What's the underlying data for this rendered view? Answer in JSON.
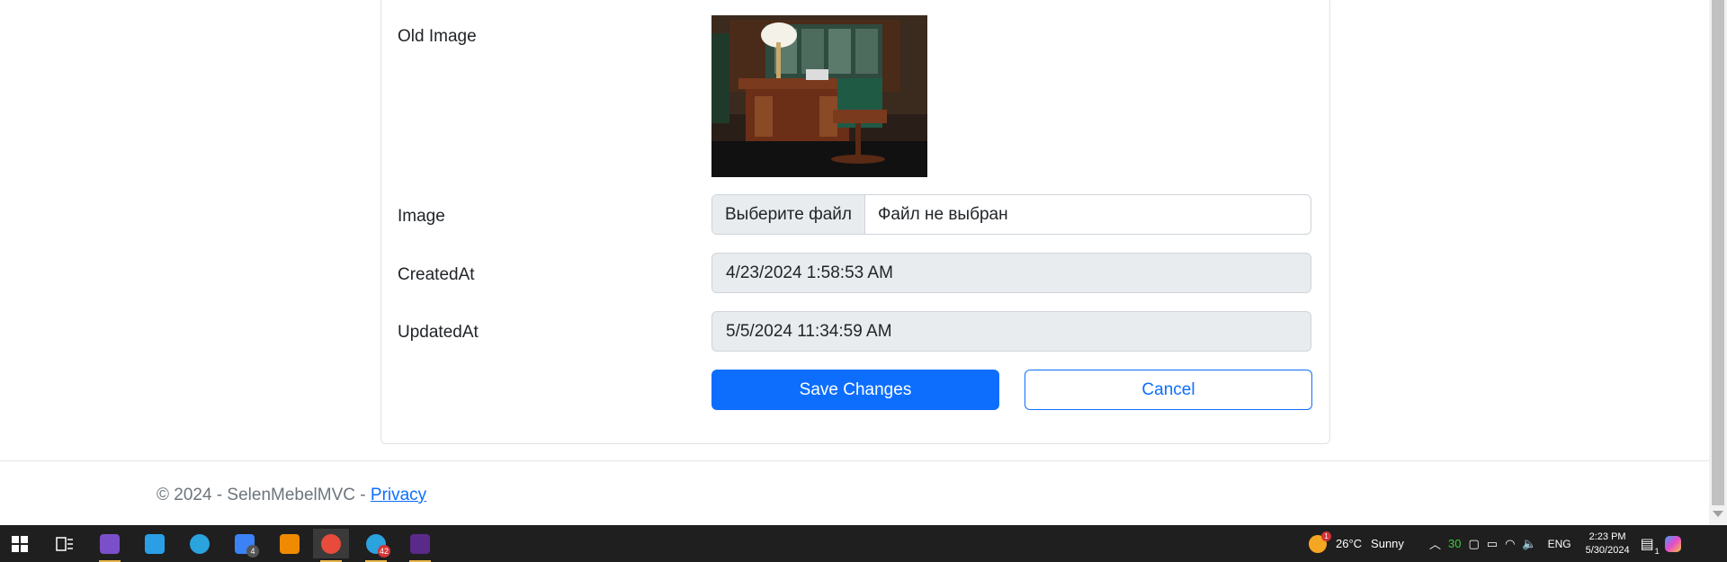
{
  "form": {
    "old_image_label": "Old Image",
    "image_label": "Image",
    "file_button_label": "Выберите файл",
    "file_status": "Файл не выбран",
    "created_label": "CreatedAt",
    "created_value": "4/23/2024 1:58:53 AM",
    "updated_label": "UpdatedAt",
    "updated_value": "5/5/2024 11:34:59 AM",
    "save_label": "Save Changes",
    "cancel_label": "Cancel"
  },
  "footer": {
    "copyright": "© 2024 - SelenMebelMVC - ",
    "privacy_link": "Privacy"
  },
  "taskbar": {
    "apps": [
      {
        "name": "visual-studio",
        "color": "#7b4fc9"
      },
      {
        "name": "vscode",
        "color": "#2a9fe5"
      },
      {
        "name": "telegram",
        "color": "#2aa3df"
      },
      {
        "name": "todo",
        "color": "#3b82f6",
        "badge": "4"
      },
      {
        "name": "vlc",
        "color": "#f08a00"
      },
      {
        "name": "chrome",
        "color": "#e84a3c"
      },
      {
        "name": "telegram-2",
        "color": "#2aa3df",
        "badge": "42"
      },
      {
        "name": "terminal",
        "color": "#5a2a8a"
      }
    ],
    "weather_temp": "26°C",
    "weather_text": "Sunny",
    "weather_badge": "1",
    "tray_count": "30",
    "language": "ENG",
    "time": "2:23 PM",
    "date": "5/30/2024",
    "notification_count": "1"
  },
  "colors": {
    "primary": "#0d6efd",
    "readonly_bg": "#e9ecef",
    "footer_text": "#6c757d",
    "taskbar_bg": "#1f1f1f",
    "active_indicator": "#e8b64a"
  }
}
